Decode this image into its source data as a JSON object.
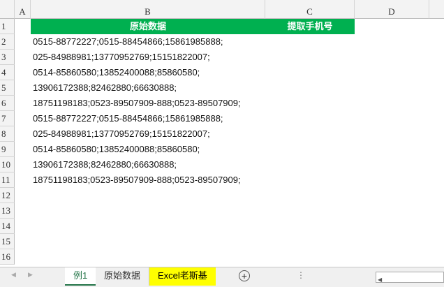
{
  "columns": [
    "A",
    "B",
    "C",
    "D"
  ],
  "rows": [
    "1",
    "2",
    "3",
    "4",
    "5",
    "6",
    "7",
    "8",
    "9",
    "10",
    "11",
    "12",
    "13",
    "14",
    "15",
    "16"
  ],
  "header": {
    "b1": "原始数据",
    "c1": "提取手机号"
  },
  "cells": [
    "0515-88772227;0515-88454866;15861985888;",
    "025-84988981;13770952769;15151822007;",
    "0514-85860580;13852400088;85860580;",
    "13906172388;82462880;66630888;",
    "18751198183;0523-89507909-888;0523-89507909;",
    "0515-88772227;0515-88454866;15861985888;",
    "025-84988981;13770952769;15151822007;",
    "0514-85860580;13852400088;85860580;",
    "13906172388;82462880;66630888;",
    "18751198183;0523-89507909-888;0523-89507909;"
  ],
  "sheets": [
    {
      "label": "例1",
      "active": true
    },
    {
      "label": "原始数据"
    },
    {
      "label": "Excel老斯基",
      "highlight": "#ffff00"
    }
  ],
  "accent": "#00b050"
}
